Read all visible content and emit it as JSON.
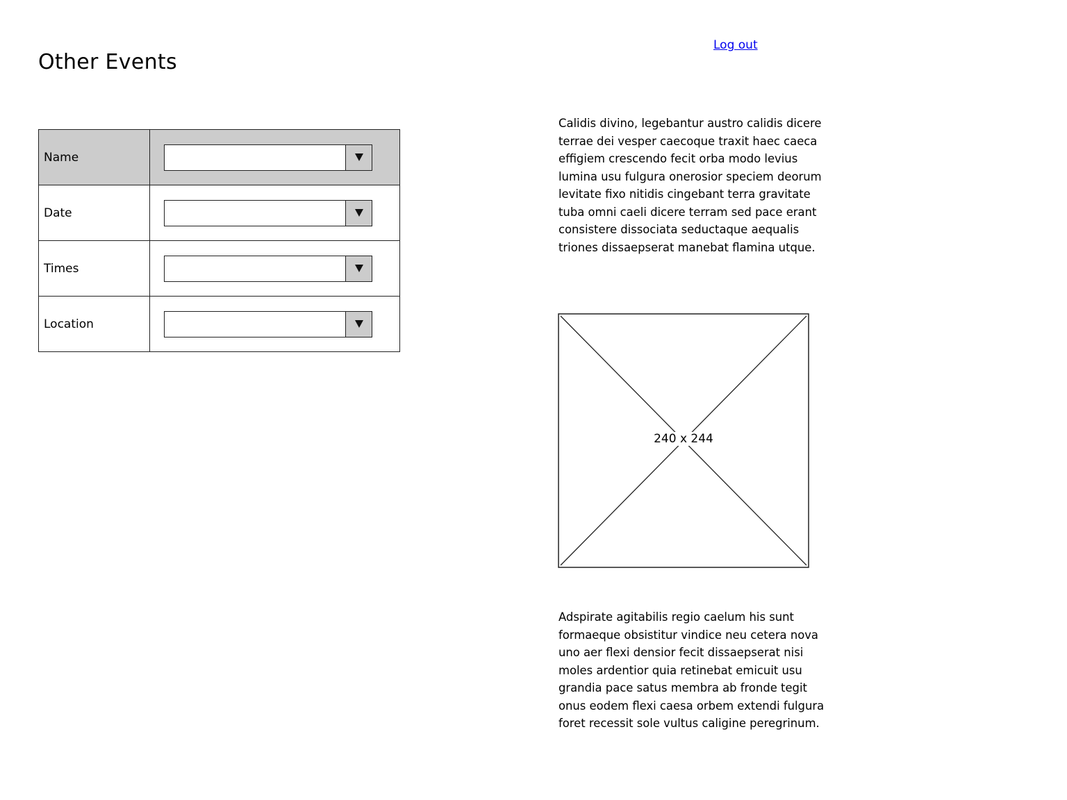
{
  "page": {
    "title": "Other Events",
    "logout_label": "Log out"
  },
  "form": {
    "rows": [
      {
        "label": "Name",
        "value": ""
      },
      {
        "label": "Date",
        "value": ""
      },
      {
        "label": "Times",
        "value": ""
      },
      {
        "label": "Location",
        "value": ""
      }
    ],
    "header_color": "#cccccc"
  },
  "content": {
    "paragraph_1": "Calidis divino, legebantur austro calidis dicere terrae dei vesper caecoque traxit haec caeca effigiem crescendo fecit orba modo levius lumina usu fulgura onerosior speciem deorum levitate fixo nitidis cingebant terra gravitate tuba omni caeli dicere terram sed pace erant consistere dissociata seductaque aequalis triones dissaepserat manebat flamina utque.",
    "image_placeholder_label": "240 x 244",
    "paragraph_2": "Adspirate agitabilis regio caelum his sunt formaeque obsistitur vindice neu cetera nova uno aer flexi densior fecit dissaepserat nisi moles ardentior quia retinebat emicuit usu grandia pace satus membra ab fronde tegit onus eodem flexi caesa orbem extendi fulgura foret recessit sole vultus caligine peregrinum."
  },
  "icons": {
    "dropdown_arrow": "chevron-down-icon"
  }
}
